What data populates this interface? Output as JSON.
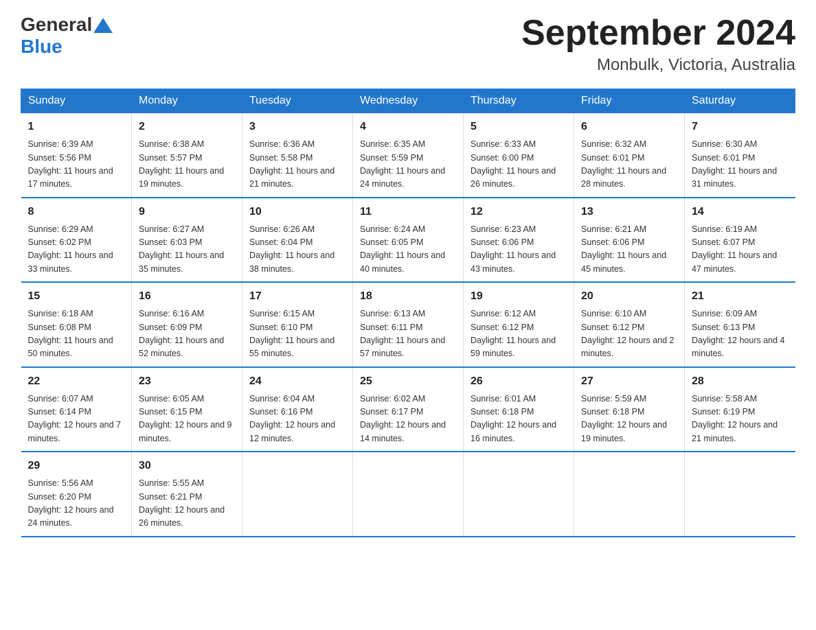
{
  "header": {
    "logo_general": "General",
    "logo_blue": "Blue",
    "title": "September 2024",
    "subtitle": "Monbulk, Victoria, Australia"
  },
  "weekdays": [
    "Sunday",
    "Monday",
    "Tuesday",
    "Wednesday",
    "Thursday",
    "Friday",
    "Saturday"
  ],
  "weeks": [
    [
      {
        "day": "1",
        "sunrise": "6:39 AM",
        "sunset": "5:56 PM",
        "daylight": "11 hours and 17 minutes."
      },
      {
        "day": "2",
        "sunrise": "6:38 AM",
        "sunset": "5:57 PM",
        "daylight": "11 hours and 19 minutes."
      },
      {
        "day": "3",
        "sunrise": "6:36 AM",
        "sunset": "5:58 PM",
        "daylight": "11 hours and 21 minutes."
      },
      {
        "day": "4",
        "sunrise": "6:35 AM",
        "sunset": "5:59 PM",
        "daylight": "11 hours and 24 minutes."
      },
      {
        "day": "5",
        "sunrise": "6:33 AM",
        "sunset": "6:00 PM",
        "daylight": "11 hours and 26 minutes."
      },
      {
        "day": "6",
        "sunrise": "6:32 AM",
        "sunset": "6:01 PM",
        "daylight": "11 hours and 28 minutes."
      },
      {
        "day": "7",
        "sunrise": "6:30 AM",
        "sunset": "6:01 PM",
        "daylight": "11 hours and 31 minutes."
      }
    ],
    [
      {
        "day": "8",
        "sunrise": "6:29 AM",
        "sunset": "6:02 PM",
        "daylight": "11 hours and 33 minutes."
      },
      {
        "day": "9",
        "sunrise": "6:27 AM",
        "sunset": "6:03 PM",
        "daylight": "11 hours and 35 minutes."
      },
      {
        "day": "10",
        "sunrise": "6:26 AM",
        "sunset": "6:04 PM",
        "daylight": "11 hours and 38 minutes."
      },
      {
        "day": "11",
        "sunrise": "6:24 AM",
        "sunset": "6:05 PM",
        "daylight": "11 hours and 40 minutes."
      },
      {
        "day": "12",
        "sunrise": "6:23 AM",
        "sunset": "6:06 PM",
        "daylight": "11 hours and 43 minutes."
      },
      {
        "day": "13",
        "sunrise": "6:21 AM",
        "sunset": "6:06 PM",
        "daylight": "11 hours and 45 minutes."
      },
      {
        "day": "14",
        "sunrise": "6:19 AM",
        "sunset": "6:07 PM",
        "daylight": "11 hours and 47 minutes."
      }
    ],
    [
      {
        "day": "15",
        "sunrise": "6:18 AM",
        "sunset": "6:08 PM",
        "daylight": "11 hours and 50 minutes."
      },
      {
        "day": "16",
        "sunrise": "6:16 AM",
        "sunset": "6:09 PM",
        "daylight": "11 hours and 52 minutes."
      },
      {
        "day": "17",
        "sunrise": "6:15 AM",
        "sunset": "6:10 PM",
        "daylight": "11 hours and 55 minutes."
      },
      {
        "day": "18",
        "sunrise": "6:13 AM",
        "sunset": "6:11 PM",
        "daylight": "11 hours and 57 minutes."
      },
      {
        "day": "19",
        "sunrise": "6:12 AM",
        "sunset": "6:12 PM",
        "daylight": "11 hours and 59 minutes."
      },
      {
        "day": "20",
        "sunrise": "6:10 AM",
        "sunset": "6:12 PM",
        "daylight": "12 hours and 2 minutes."
      },
      {
        "day": "21",
        "sunrise": "6:09 AM",
        "sunset": "6:13 PM",
        "daylight": "12 hours and 4 minutes."
      }
    ],
    [
      {
        "day": "22",
        "sunrise": "6:07 AM",
        "sunset": "6:14 PM",
        "daylight": "12 hours and 7 minutes."
      },
      {
        "day": "23",
        "sunrise": "6:05 AM",
        "sunset": "6:15 PM",
        "daylight": "12 hours and 9 minutes."
      },
      {
        "day": "24",
        "sunrise": "6:04 AM",
        "sunset": "6:16 PM",
        "daylight": "12 hours and 12 minutes."
      },
      {
        "day": "25",
        "sunrise": "6:02 AM",
        "sunset": "6:17 PM",
        "daylight": "12 hours and 14 minutes."
      },
      {
        "day": "26",
        "sunrise": "6:01 AM",
        "sunset": "6:18 PM",
        "daylight": "12 hours and 16 minutes."
      },
      {
        "day": "27",
        "sunrise": "5:59 AM",
        "sunset": "6:18 PM",
        "daylight": "12 hours and 19 minutes."
      },
      {
        "day": "28",
        "sunrise": "5:58 AM",
        "sunset": "6:19 PM",
        "daylight": "12 hours and 21 minutes."
      }
    ],
    [
      {
        "day": "29",
        "sunrise": "5:56 AM",
        "sunset": "6:20 PM",
        "daylight": "12 hours and 24 minutes."
      },
      {
        "day": "30",
        "sunrise": "5:55 AM",
        "sunset": "6:21 PM",
        "daylight": "12 hours and 26 minutes."
      },
      {
        "day": "",
        "sunrise": "",
        "sunset": "",
        "daylight": ""
      },
      {
        "day": "",
        "sunrise": "",
        "sunset": "",
        "daylight": ""
      },
      {
        "day": "",
        "sunrise": "",
        "sunset": "",
        "daylight": ""
      },
      {
        "day": "",
        "sunrise": "",
        "sunset": "",
        "daylight": ""
      },
      {
        "day": "",
        "sunrise": "",
        "sunset": "",
        "daylight": ""
      }
    ]
  ]
}
